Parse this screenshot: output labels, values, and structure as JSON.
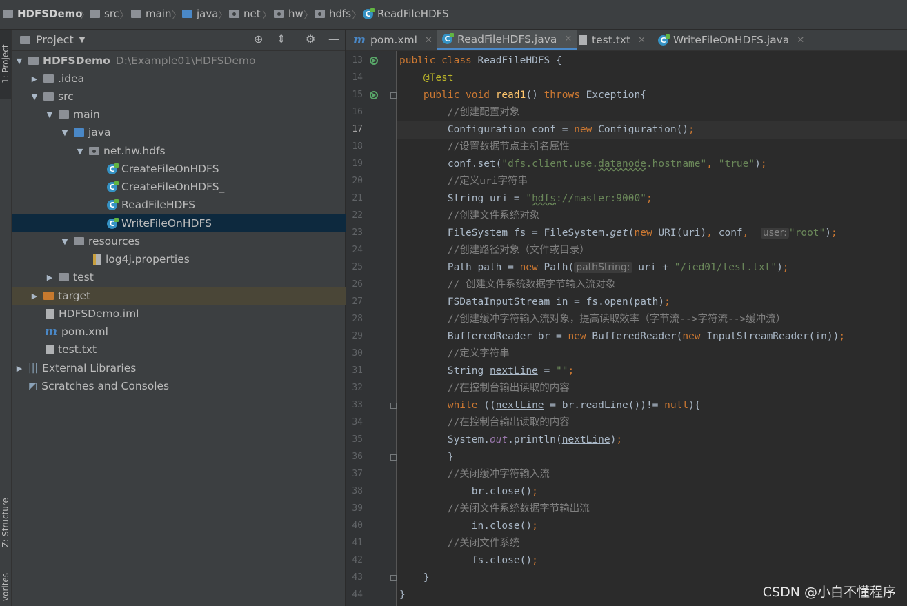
{
  "breadcrumb": {
    "project": "HDFSDemo",
    "src": "src",
    "main": "main",
    "java": "java",
    "net": "net",
    "hw": "hw",
    "hdfs": "hdfs",
    "file": "ReadFileHDFS"
  },
  "side_strip": {
    "project_tab": "1: Project",
    "structure_tab": "Z: Structure",
    "favorites_tab": "vorites"
  },
  "project_panel": {
    "title": "Project",
    "tree": {
      "root": "HDFSDemo",
      "root_path": "D:\\Example01\\HDFSDemo",
      "idea": ".idea",
      "src": "src",
      "main": "main",
      "java": "java",
      "package": "net.hw.hdfs",
      "class1": "CreateFileOnHDFS",
      "class2": "CreateFileOnHDFS_",
      "class3": "ReadFileHDFS",
      "class4": "WriteFileOnHDFS",
      "resources": "resources",
      "log4j": "log4j.properties",
      "test": "test",
      "target": "target",
      "iml": "HDFSDemo.iml",
      "pom": "pom.xml",
      "testtxt": "test.txt",
      "ext": "External Libraries",
      "scratch": "Scratches and Consoles"
    }
  },
  "tabs": [
    "pom.xml",
    "ReadFileHDFS.java",
    "test.txt",
    "WriteFileOnHDFS.java"
  ],
  "active_tab": "ReadFileHDFS.java",
  "line_numbers": [
    "13",
    "14",
    "15",
    "16",
    "17",
    "18",
    "19",
    "20",
    "21",
    "22",
    "23",
    "24",
    "25",
    "26",
    "27",
    "28",
    "29",
    "30",
    "31",
    "32",
    "33",
    "34",
    "35",
    "36",
    "37",
    "38",
    "39",
    "40",
    "41",
    "42",
    "43",
    "44"
  ],
  "current_line": "17",
  "code": {
    "l13": [
      "public",
      "class",
      "ReadFileHDFS {"
    ],
    "l14": "@Test",
    "l15": [
      "public",
      "void",
      "read1",
      "() ",
      "throws",
      " Exception{"
    ],
    "l16": "//创建配置对象",
    "l17": [
      "Configuration conf = ",
      "new",
      " Configuration()",
      ";"
    ],
    "l18": "//设置数据节点主机名属性",
    "l19": [
      "conf.set(",
      "\"dfs.client.use.",
      "datanode",
      ".hostname\"",
      ", ",
      "\"true\"",
      ")",
      ";"
    ],
    "l20": "//定义uri字符串",
    "l21": [
      "String uri = ",
      "\"",
      "hdfs",
      "://master:9000\"",
      ";"
    ],
    "l22": "//创建文件系统对象",
    "l23": [
      "FileSystem fs = FileSystem.",
      "get",
      "(",
      "new",
      " URI(uri)",
      ", ",
      "conf",
      ", ",
      "user:",
      "\"root\"",
      ")",
      ";"
    ],
    "l24": "//创建路径对象（文件或目录）",
    "l25": [
      "Path path = ",
      "new",
      " Path(",
      "pathString:",
      "uri + ",
      "\"/ied01/test.txt\"",
      ")",
      ";"
    ],
    "l26": "// 创建文件系统数据字节输入流对象",
    "l27": [
      "FSDataInputStream in = fs.open(path)",
      ";"
    ],
    "l28": "//创建缓冲字符输入流对象，提高读取效率（字节流-->字符流-->缓冲流）",
    "l29": [
      "BufferedReader br = ",
      "new",
      " BufferedReader(",
      "new",
      " InputStreamReader(in))",
      ";"
    ],
    "l30": "//定义字符串",
    "l31": [
      "String ",
      "nextLine",
      " = ",
      "\"\"",
      ";"
    ],
    "l32": "//在控制台输出读取的内容",
    "l33": [
      "while",
      " ((",
      "nextLine",
      " = br.readLine())!= ",
      "null",
      "){"
    ],
    "l34": "//在控制台输出读取的内容",
    "l35": [
      "System.",
      "out",
      ".println(",
      "nextLine",
      ")",
      ";"
    ],
    "l36": "}",
    "l37": "//关闭缓冲字符输入流",
    "l38": [
      "br.close()",
      ";"
    ],
    "l39": "//关闭文件系统数据字节输出流",
    "l40": [
      "in.close()",
      ";"
    ],
    "l41": "//关闭文件系统",
    "l42": [
      "fs.close()",
      ";"
    ],
    "l43": "}",
    "l44": "}"
  },
  "watermark": "CSDN @小白不懂程序"
}
